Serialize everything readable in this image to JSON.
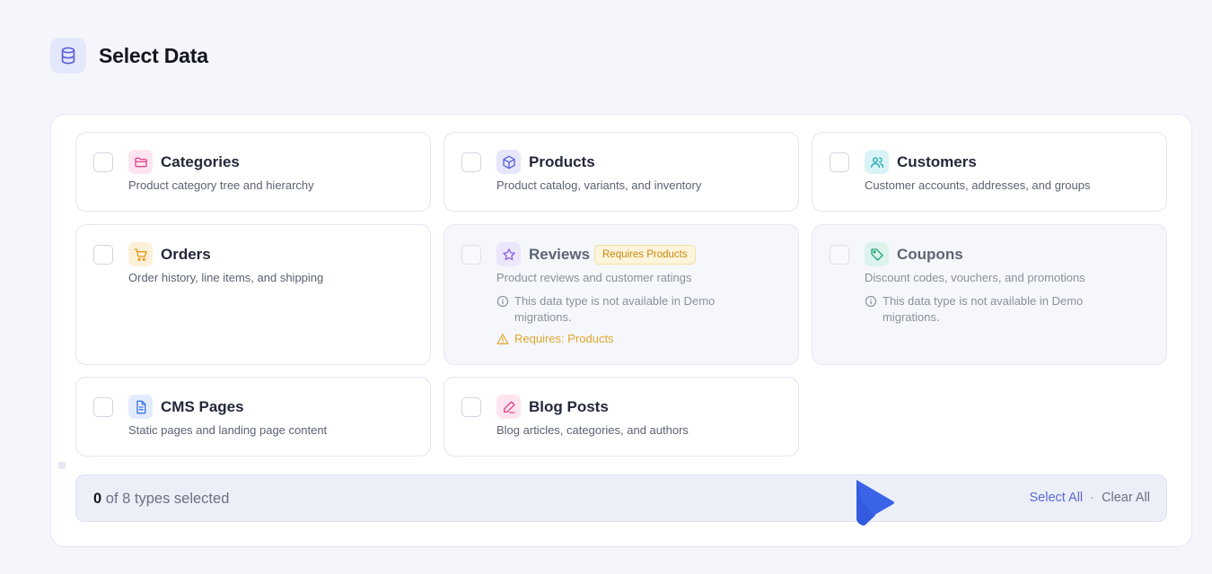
{
  "header": {
    "title": "Select Data",
    "icon": "database-icon"
  },
  "cards": [
    {
      "title": "Categories",
      "desc": "Product category tree and hierarchy",
      "icon": "folder-icon",
      "icon_bg": "#fde4f0",
      "icon_color": "#e0468f"
    },
    {
      "title": "Products",
      "desc": "Product catalog, variants, and inventory",
      "icon": "box-icon",
      "icon_bg": "#e6e7fb",
      "icon_color": "#5b5fd6"
    },
    {
      "title": "Customers",
      "desc": "Customer accounts, addresses, and groups",
      "icon": "users-icon",
      "icon_bg": "#d9f3f7",
      "icon_color": "#1aa6b7"
    },
    {
      "title": "Orders",
      "desc": "Order history, line items, and shipping",
      "icon": "cart-icon",
      "icon_bg": "#fdf0d8",
      "icon_color": "#e09a18"
    },
    {
      "title": "Reviews",
      "badge": "Requires Products",
      "desc": "Product reviews and customer ratings",
      "note": "This data type is not available in Demo migrations.",
      "warning": "Requires: Products",
      "icon": "star-icon",
      "icon_bg": "#ece6fb",
      "icon_color": "#8a63e6"
    },
    {
      "title": "Coupons",
      "desc": "Discount codes, vouchers, and promotions",
      "note": "This data type is not available in Demo migrations.",
      "icon": "tag-icon",
      "icon_bg": "#dcf3ec",
      "icon_color": "#22a57d"
    },
    {
      "title": "CMS Pages",
      "desc": "Static pages and landing page content",
      "icon": "document-icon",
      "icon_bg": "#e2ebfb",
      "icon_color": "#3b74e0"
    },
    {
      "title": "Blog Posts",
      "desc": "Blog articles, categories, and authors",
      "icon": "pen-icon",
      "icon_bg": "#fde4ee",
      "icon_color": "#e0468f"
    }
  ],
  "footer": {
    "selected_count": "0",
    "count_suffix": "of 8 types selected",
    "select_all": "Select All",
    "separator": "·",
    "clear_all": "Clear All"
  },
  "colors": {
    "accent": "#5b6ad6",
    "cursor": "#3a63e8",
    "warning": "#e0a62c"
  }
}
